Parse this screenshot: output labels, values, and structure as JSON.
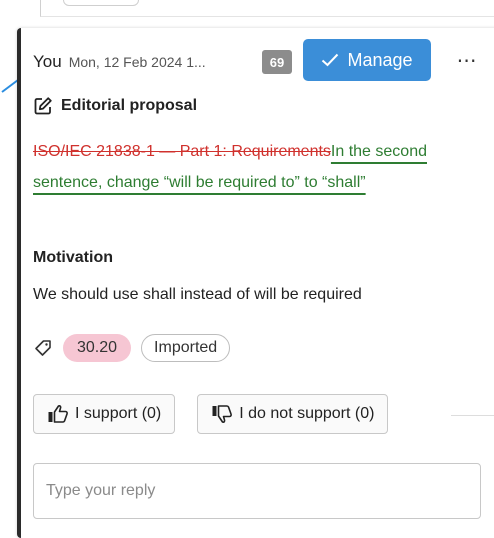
{
  "comment": {
    "author": "You",
    "date": "Mon, 12 Feb 2024 1...",
    "badge_count": "69",
    "manage_label": "Manage",
    "more_icon": "⋯",
    "type_label": "Editorial proposal",
    "proposal": {
      "deleted_text": "ISO/IEC 21838-1 — Part 1: Requirements",
      "inserted_text": "In the second sentence, change “will be required to” to “shall”"
    },
    "motivation_heading": "Motivation",
    "motivation_text": "We should use shall instead of will be required",
    "tags": [
      {
        "label": "30.20",
        "style": "pink"
      },
      {
        "label": "Imported",
        "style": "outline"
      }
    ],
    "support_label": "I support (0)",
    "not_support_label": "I do not support (0)",
    "reply_placeholder": "Type your reply"
  },
  "colors": {
    "accent": "#3b8ed8",
    "deleted": "#d0312d",
    "inserted": "#2e7d32",
    "tag_pink": "#f6c6d3",
    "badge": "#8c8c8c"
  },
  "icons": {
    "arrow": "pointer-arrow-icon",
    "check": "check-icon",
    "edit": "edit-icon",
    "tag": "tag-icon",
    "thumbs_up": "thumbs-up-icon",
    "thumbs_down": "thumbs-down-icon"
  }
}
